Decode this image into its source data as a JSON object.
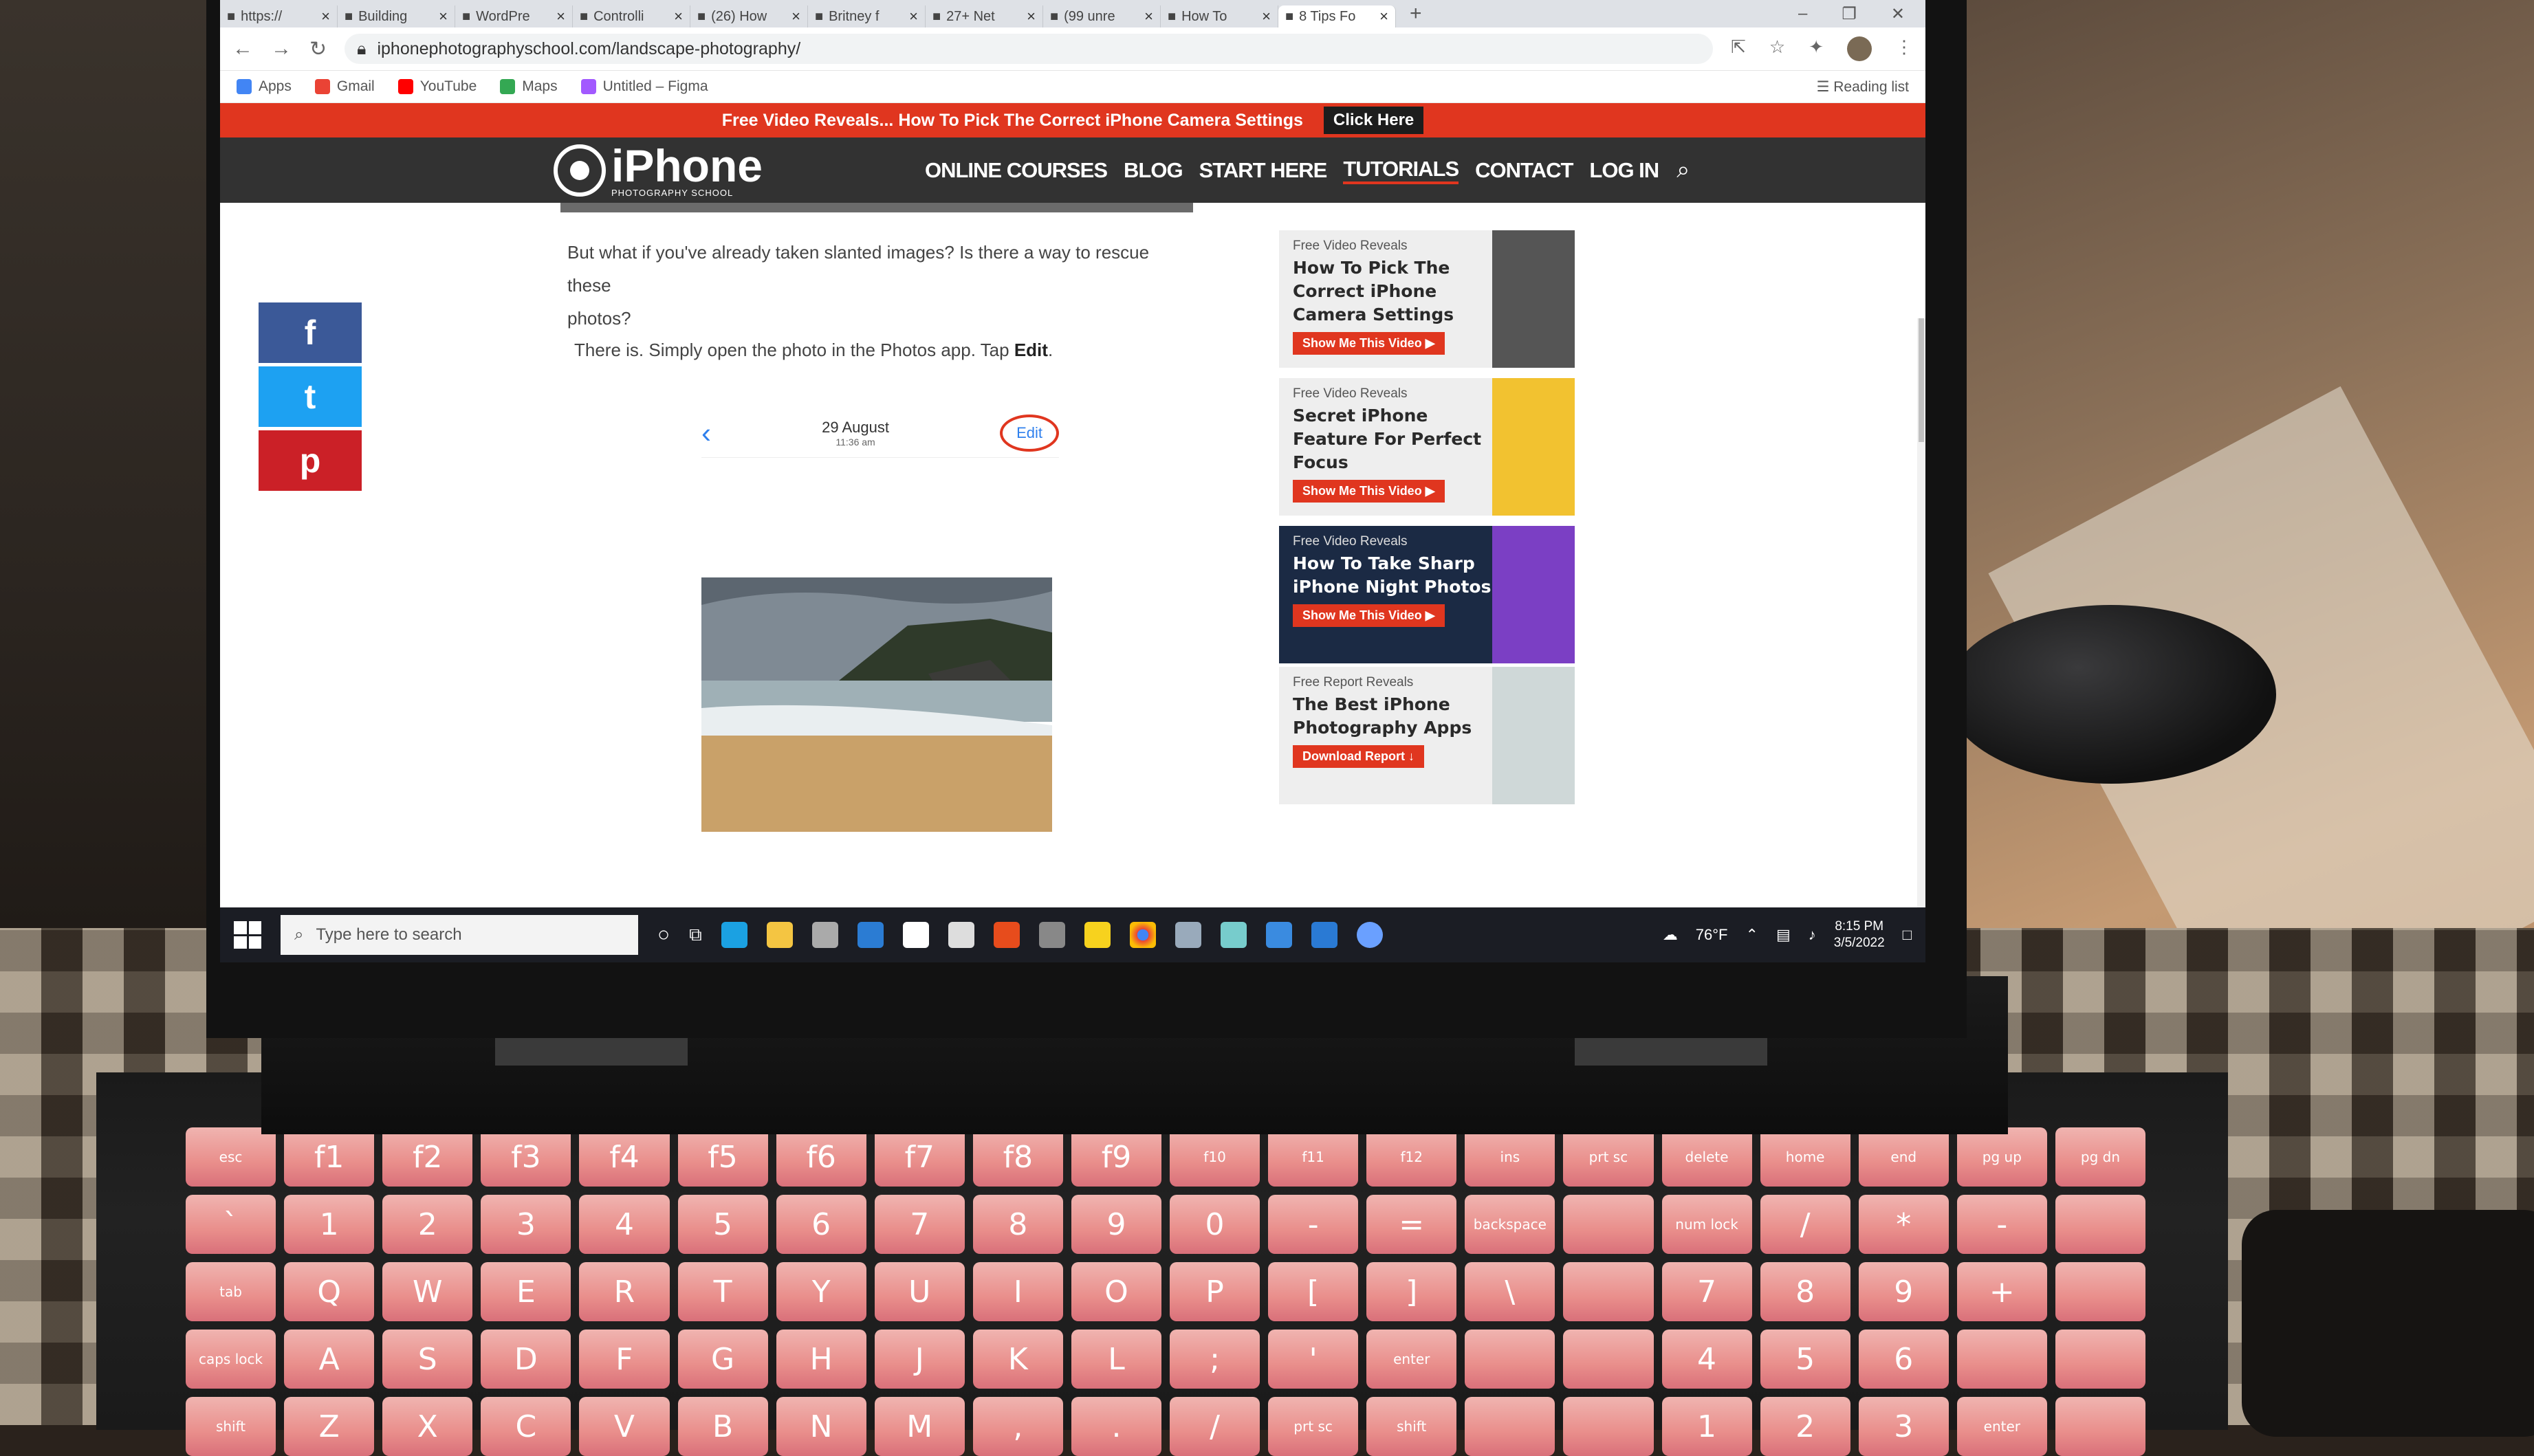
{
  "browser": {
    "tabs": [
      {
        "label": "https://",
        "active": false
      },
      {
        "label": "Building",
        "active": false
      },
      {
        "label": "WordPre",
        "active": false
      },
      {
        "label": "Controlli",
        "active": false
      },
      {
        "label": "(26) How",
        "active": false
      },
      {
        "label": "Britney f",
        "active": false
      },
      {
        "label": "27+ Net",
        "active": false
      },
      {
        "label": "(99 unre",
        "active": false
      },
      {
        "label": "How To",
        "active": false
      },
      {
        "label": "8 Tips Fo",
        "active": true
      }
    ],
    "new_tab_icon": "+",
    "url": "iphonephotographyschool.com/landscape-photography/",
    "bookmarks": [
      {
        "label": "Apps",
        "icon": "apps-grid-icon",
        "color": "#4285f4"
      },
      {
        "label": "Gmail",
        "icon": "gmail-icon",
        "color": "#ea4335"
      },
      {
        "label": "YouTube",
        "icon": "youtube-icon",
        "color": "#ff0000"
      },
      {
        "label": "Maps",
        "icon": "maps-icon",
        "color": "#34a853"
      },
      {
        "label": "Untitled – Figma",
        "icon": "figma-icon",
        "color": "#a259ff"
      }
    ],
    "reading_list": "Reading list"
  },
  "site": {
    "promo_text": "Free Video Reveals... How To Pick The Correct iPhone Camera Settings",
    "promo_button": "Click Here",
    "logo_main": "iPhone",
    "logo_sub": "PHOTOGRAPHY SCHOOL",
    "nav": [
      "ONLINE COURSES",
      "BLOG",
      "START HERE",
      "TUTORIALS",
      "CONTACT",
      "LOG IN"
    ],
    "nav_active": "TUTORIALS",
    "accent": "#e0361f",
    "header_bg": "#323232"
  },
  "article": {
    "para1_line1": "But what if you've already taken slanted images? Is there a way to rescue these",
    "para1_line2": "photos?",
    "para2_prefix": "There is. Simply open the photo in the Photos app. Tap ",
    "para2_bold": "Edit",
    "para2_suffix": ".",
    "phone_date": "29 August",
    "phone_time": "11:36 am",
    "phone_edit": "Edit"
  },
  "share": [
    {
      "label": "f",
      "icon": "facebook-icon",
      "color": "#3b5998"
    },
    {
      "label": "t",
      "icon": "twitter-icon",
      "color": "#1da1f2"
    },
    {
      "label": "p",
      "icon": "pinterest-icon",
      "color": "#cb2027"
    }
  ],
  "sidebar_ads": [
    {
      "kicker": "Free Video Reveals",
      "title": "How To Pick The Correct iPhone Camera Settings",
      "button": "Show Me This Video ▶",
      "dark": false
    },
    {
      "kicker": "Free Video Reveals",
      "title": "Secret iPhone Feature For Perfect Focus",
      "button": "Show Me This Video ▶",
      "dark": false
    },
    {
      "kicker": "Free Video Reveals",
      "title": "How To Take Sharp iPhone Night Photos",
      "button": "Show Me This Video ▶",
      "dark": true
    },
    {
      "kicker": "Free Report Reveals",
      "title": "The Best iPhone Photography Apps",
      "button": "Download Report ↓",
      "dark": false
    }
  ],
  "taskbar": {
    "search_placeholder": "Type here to search",
    "weather": "76°F",
    "time": "8:15 PM",
    "date": "3/5/2022"
  },
  "laptop": {
    "key_rows": [
      [
        "esc",
        "f1",
        "f2",
        "f3",
        "f4",
        "f5",
        "f6",
        "f7",
        "f8",
        "f9",
        "f10",
        "f11",
        "f12",
        "ins",
        "prt sc",
        "delete",
        "home",
        "end",
        "pg up",
        "pg dn"
      ],
      [
        "`",
        "1",
        "2",
        "3",
        "4",
        "5",
        "6",
        "7",
        "8",
        "9",
        "0",
        "-",
        "=",
        "backspace",
        "",
        "num lock",
        "/",
        "*",
        "-",
        ""
      ],
      [
        "tab",
        "Q",
        "W",
        "E",
        "R",
        "T",
        "Y",
        "U",
        "I",
        "O",
        "P",
        "[",
        "]",
        "\\",
        "",
        "7",
        "8",
        "9",
        "+",
        ""
      ],
      [
        "caps lock",
        "A",
        "S",
        "D",
        "F",
        "G",
        "H",
        "J",
        "K",
        "L",
        ";",
        "'",
        "enter",
        "",
        "",
        "4",
        "5",
        "6",
        "",
        ""
      ],
      [
        "shift",
        "Z",
        "X",
        "C",
        "V",
        "B",
        "N",
        "M",
        ",",
        ".",
        "/",
        "prt sc",
        "shift",
        "",
        "",
        "1",
        "2",
        "3",
        "enter",
        ""
      ]
    ]
  }
}
